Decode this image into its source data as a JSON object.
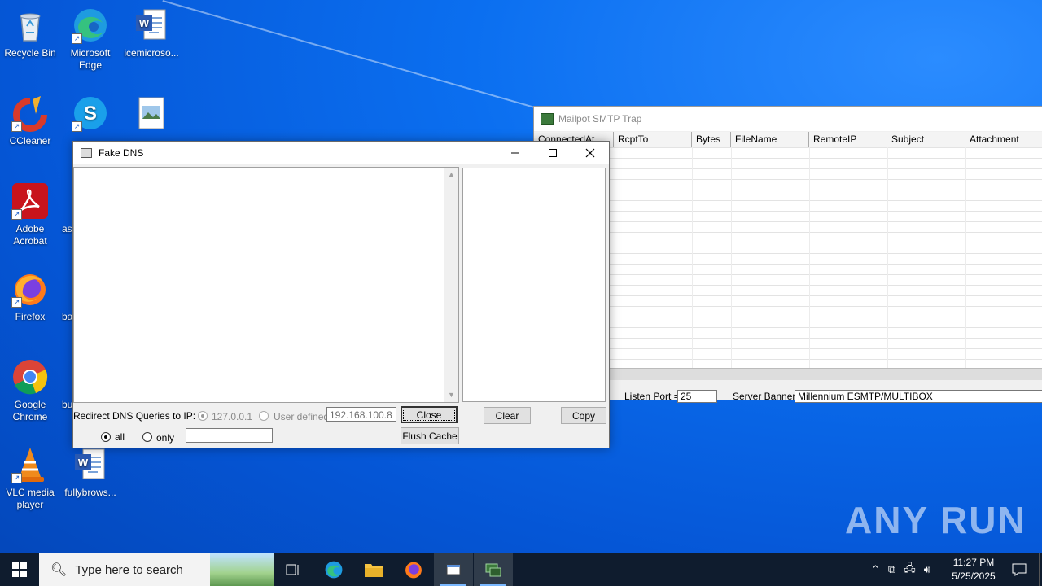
{
  "desktop": {
    "icons": [
      {
        "label": "Recycle Bin"
      },
      {
        "label": "Microsoft Edge"
      },
      {
        "label": "icemicroso..."
      },
      {
        "label": "CCleaner"
      },
      {
        "label": "Skype"
      },
      {
        "label": "Adobe Acrobat"
      },
      {
        "label": "Firefox"
      },
      {
        "label": "Google Chrome"
      },
      {
        "label": "VLC media player"
      },
      {
        "label": "fullybrows..."
      }
    ],
    "partial_labels": [
      "as",
      "ba",
      "bu"
    ]
  },
  "mailpot": {
    "title": "Mailpot SMTP Trap",
    "columns": [
      "ConnectedAt",
      "RcptTo",
      "Bytes",
      "FileName",
      "RemoteIP",
      "Subject",
      "Attachment"
    ],
    "status": {
      "listen_port_label": "Listen Port =",
      "listen_port_value": "25",
      "server_banner_label": "Server Banner",
      "server_banner_value": "Millennium ESMTP/MULTIBOX"
    }
  },
  "fakedns": {
    "title": "Fake DNS",
    "redirect_label": "Redirect DNS Queries to IP:",
    "option_loopback": "127.0.0.1",
    "option_user_defined": "User defined",
    "ip_value": "192.168.100.8",
    "scope_all": "all",
    "scope_only": "only",
    "only_value": "",
    "buttons": {
      "close": "Close",
      "flush_cache": "Flush Cache",
      "clear": "Clear",
      "copy": "Copy"
    }
  },
  "watermark": "ANY RUN",
  "taskbar": {
    "search_placeholder": "Type here to search",
    "time": "11:27 PM",
    "date": "5/25/2025"
  },
  "colors": {
    "desktop_blue": "#0b6ff0",
    "taskbar": "#0f1c2e"
  }
}
